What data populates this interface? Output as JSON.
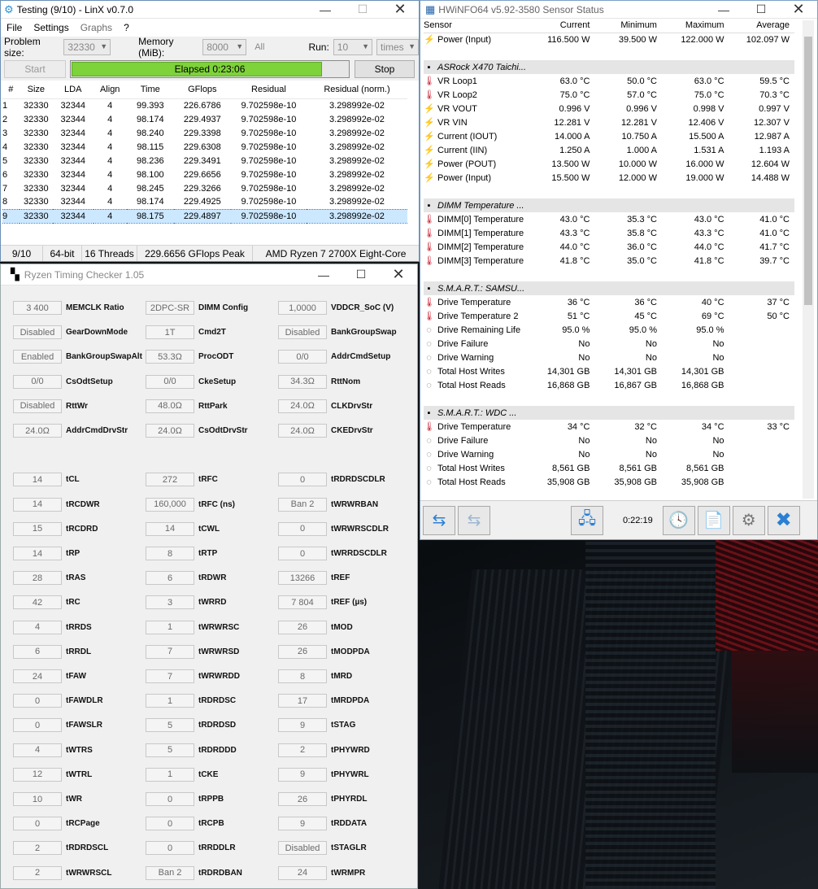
{
  "linx": {
    "title": "Testing (9/10) - LinX v0.7.0",
    "menu": [
      "File",
      "Settings",
      "Graphs",
      "?"
    ],
    "problem_size_label": "Problem size:",
    "problem_size": "32330",
    "memory_label": "Memory (MiB):",
    "memory": "8000",
    "all_label": "All",
    "run_label": "Run:",
    "run": "10",
    "run_unit": "times",
    "start_label": "Start",
    "stop_label": "Stop",
    "elapsed": "Elapsed 0:23:06",
    "progress": 0.9,
    "columns": [
      "#",
      "Size",
      "LDA",
      "Align",
      "Time",
      "GFlops",
      "Residual",
      "Residual (norm.)"
    ],
    "rows": [
      [
        "1",
        "32330",
        "32344",
        "4",
        "99.393",
        "226.6786",
        "9.702598e-10",
        "3.298992e-02"
      ],
      [
        "2",
        "32330",
        "32344",
        "4",
        "98.174",
        "229.4937",
        "9.702598e-10",
        "3.298992e-02"
      ],
      [
        "3",
        "32330",
        "32344",
        "4",
        "98.240",
        "229.3398",
        "9.702598e-10",
        "3.298992e-02"
      ],
      [
        "4",
        "32330",
        "32344",
        "4",
        "98.115",
        "229.6308",
        "9.702598e-10",
        "3.298992e-02"
      ],
      [
        "5",
        "32330",
        "32344",
        "4",
        "98.236",
        "229.3491",
        "9.702598e-10",
        "3.298992e-02"
      ],
      [
        "6",
        "32330",
        "32344",
        "4",
        "98.100",
        "229.6656",
        "9.702598e-10",
        "3.298992e-02"
      ],
      [
        "7",
        "32330",
        "32344",
        "4",
        "98.245",
        "229.3266",
        "9.702598e-10",
        "3.298992e-02"
      ],
      [
        "8",
        "32330",
        "32344",
        "4",
        "98.174",
        "229.4925",
        "9.702598e-10",
        "3.298992e-02"
      ],
      [
        "9",
        "32330",
        "32344",
        "4",
        "98.175",
        "229.4897",
        "9.702598e-10",
        "3.298992e-02"
      ]
    ],
    "status": [
      "9/10",
      "64-bit",
      "16 Threads",
      "229.6656 GFlops Peak",
      "AMD Ryzen 7 2700X Eight-Core"
    ]
  },
  "rtc": {
    "title": "Ryzen Timing Checker 1.05",
    "cols": [
      [
        [
          "3 400",
          "MEMCLK Ratio"
        ],
        [
          "Disabled",
          "GearDownMode"
        ],
        [
          "Enabled",
          "BankGroupSwapAlt"
        ],
        [
          "0/0",
          "CsOdtSetup"
        ],
        [
          "Disabled",
          "RttWr"
        ],
        [
          "24.0Ω",
          "AddrCmdDrvStr"
        ],
        null,
        [
          "14",
          "tCL"
        ],
        [
          "14",
          "tRCDWR"
        ],
        [
          "15",
          "tRCDRD"
        ],
        [
          "14",
          "tRP"
        ],
        [
          "28",
          "tRAS"
        ],
        [
          "42",
          "tRC"
        ],
        [
          "4",
          "tRRDS"
        ],
        [
          "6",
          "tRRDL"
        ],
        [
          "24",
          "tFAW"
        ],
        [
          "0",
          "tFAWDLR"
        ],
        [
          "0",
          "tFAWSLR"
        ],
        [
          "4",
          "tWTRS"
        ],
        [
          "12",
          "tWTRL"
        ],
        [
          "10",
          "tWR"
        ],
        [
          "0",
          "tRCPage"
        ],
        [
          "2",
          "tRDRDSCL"
        ],
        [
          "2",
          "tWRWRSCL"
        ]
      ],
      [
        [
          "2DPC-SR",
          "DIMM Config"
        ],
        [
          "1T",
          "Cmd2T"
        ],
        [
          "53.3Ω",
          "ProcODT"
        ],
        [
          "0/0",
          "CkeSetup"
        ],
        [
          "48.0Ω",
          "RttPark"
        ],
        [
          "24.0Ω",
          "CsOdtDrvStr"
        ],
        null,
        [
          "272",
          "tRFC"
        ],
        [
          "160,000",
          "tRFC (ns)"
        ],
        [
          "14",
          "tCWL"
        ],
        [
          "8",
          "tRTP"
        ],
        [
          "6",
          "tRDWR"
        ],
        [
          "3",
          "tWRRD"
        ],
        [
          "1",
          "tWRWRSC"
        ],
        [
          "7",
          "tWRWRSD"
        ],
        [
          "7",
          "tWRWRDD"
        ],
        [
          "1",
          "tRDRDSC"
        ],
        [
          "5",
          "tRDRDSD"
        ],
        [
          "5",
          "tRDRDDD"
        ],
        [
          "1",
          "tCKE"
        ],
        [
          "0",
          "tRPPB"
        ],
        [
          "0",
          "tRCPB"
        ],
        [
          "0",
          "tRRDDLR"
        ],
        [
          "Ban 2",
          "tRDRDBAN"
        ]
      ],
      [
        [
          "1,0000",
          "VDDCR_SoC (V)"
        ],
        [
          "Disabled",
          "BankGroupSwap"
        ],
        [
          "0/0",
          "AddrCmdSetup"
        ],
        [
          "34.3Ω",
          "RttNom"
        ],
        [
          "24.0Ω",
          "CLKDrvStr"
        ],
        [
          "24.0Ω",
          "CKEDrvStr"
        ],
        null,
        [
          "0",
          "tRDRDSCDLR"
        ],
        [
          "Ban 2",
          "tWRWRBAN"
        ],
        [
          "0",
          "tWRWRSCDLR"
        ],
        [
          "0",
          "tWRRDSCDLR"
        ],
        [
          "13266",
          "tREF"
        ],
        [
          "7 804",
          "tREF (µs)"
        ],
        [
          "26",
          "tMOD"
        ],
        [
          "26",
          "tMODPDA"
        ],
        [
          "8",
          "tMRD"
        ],
        [
          "17",
          "tMRDPDA"
        ],
        [
          "9",
          "tSTAG"
        ],
        [
          "2",
          "tPHYWRD"
        ],
        [
          "9",
          "tPHYWRL"
        ],
        [
          "26",
          "tPHYRDL"
        ],
        [
          "9",
          "tRDDATA"
        ],
        [
          "Disabled",
          "tSTAGLR"
        ],
        [
          "24",
          "tWRMPR"
        ]
      ]
    ]
  },
  "hw": {
    "title": "HWiNFO64 v5.92-3580 Sensor Status",
    "headers": [
      "Sensor",
      "Current",
      "Minimum",
      "Maximum",
      "Average"
    ],
    "rows": [
      [
        "bolt",
        "Power (Input)",
        "116.500 W",
        "39.500 W",
        "122.000 W",
        "102.097 W"
      ],
      [
        "gap"
      ],
      [
        "grp",
        "ASRock X470 Taichi..."
      ],
      [
        "therm",
        "VR Loop1",
        "63.0 °C",
        "50.0 °C",
        "63.0 °C",
        "59.5 °C"
      ],
      [
        "therm",
        "VR Loop2",
        "75.0 °C",
        "57.0 °C",
        "75.0 °C",
        "70.3 °C"
      ],
      [
        "bolt",
        "VR VOUT",
        "0.996 V",
        "0.996 V",
        "0.998 V",
        "0.997 V"
      ],
      [
        "bolt",
        "VR VIN",
        "12.281 V",
        "12.281 V",
        "12.406 V",
        "12.307 V"
      ],
      [
        "bolt",
        "Current (IOUT)",
        "14.000 A",
        "10.750 A",
        "15.500 A",
        "12.987 A"
      ],
      [
        "bolt",
        "Current (IIN)",
        "1.250 A",
        "1.000 A",
        "1.531 A",
        "1.193 A"
      ],
      [
        "bolt",
        "Power (POUT)",
        "13.500 W",
        "10.000 W",
        "16.000 W",
        "12.604 W"
      ],
      [
        "bolt",
        "Power (Input)",
        "15.500 W",
        "12.000 W",
        "19.000 W",
        "14.488 W"
      ],
      [
        "gap"
      ],
      [
        "grp",
        "DIMM Temperature ..."
      ],
      [
        "therm",
        "DIMM[0] Temperature",
        "43.0 °C",
        "35.3 °C",
        "43.0 °C",
        "41.0 °C"
      ],
      [
        "therm",
        "DIMM[1] Temperature",
        "43.3 °C",
        "35.8 °C",
        "43.3 °C",
        "41.0 °C"
      ],
      [
        "therm",
        "DIMM[2] Temperature",
        "44.0 °C",
        "36.0 °C",
        "44.0 °C",
        "41.7 °C"
      ],
      [
        "therm",
        "DIMM[3] Temperature",
        "41.8 °C",
        "35.0 °C",
        "41.8 °C",
        "39.7 °C"
      ],
      [
        "gap"
      ],
      [
        "grp",
        "S.M.A.R.T.: SAMSU..."
      ],
      [
        "therm",
        "Drive Temperature",
        "36 °C",
        "36 °C",
        "40 °C",
        "37 °C"
      ],
      [
        "therm",
        "Drive Temperature 2",
        "51 °C",
        "45 °C",
        "69 °C",
        "50 °C"
      ],
      [
        "circ",
        "Drive Remaining Life",
        "95.0 %",
        "95.0 %",
        "95.0 %",
        ""
      ],
      [
        "circ",
        "Drive Failure",
        "No",
        "No",
        "No",
        ""
      ],
      [
        "circ",
        "Drive Warning",
        "No",
        "No",
        "No",
        ""
      ],
      [
        "circ",
        "Total Host Writes",
        "14,301 GB",
        "14,301 GB",
        "14,301 GB",
        ""
      ],
      [
        "circ",
        "Total Host Reads",
        "16,868 GB",
        "16,867 GB",
        "16,868 GB",
        ""
      ],
      [
        "gap"
      ],
      [
        "grp",
        "S.M.A.R.T.: WDC ..."
      ],
      [
        "therm",
        "Drive Temperature",
        "34 °C",
        "32 °C",
        "34 °C",
        "33 °C"
      ],
      [
        "circ",
        "Drive Failure",
        "No",
        "No",
        "No",
        ""
      ],
      [
        "circ",
        "Drive Warning",
        "No",
        "No",
        "No",
        ""
      ],
      [
        "circ",
        "Total Host Writes",
        "8,561 GB",
        "8,561 GB",
        "8,561 GB",
        ""
      ],
      [
        "circ",
        "Total Host Reads",
        "35,908 GB",
        "35,908 GB",
        "35,908 GB",
        ""
      ]
    ],
    "timer": "0:22:19"
  }
}
